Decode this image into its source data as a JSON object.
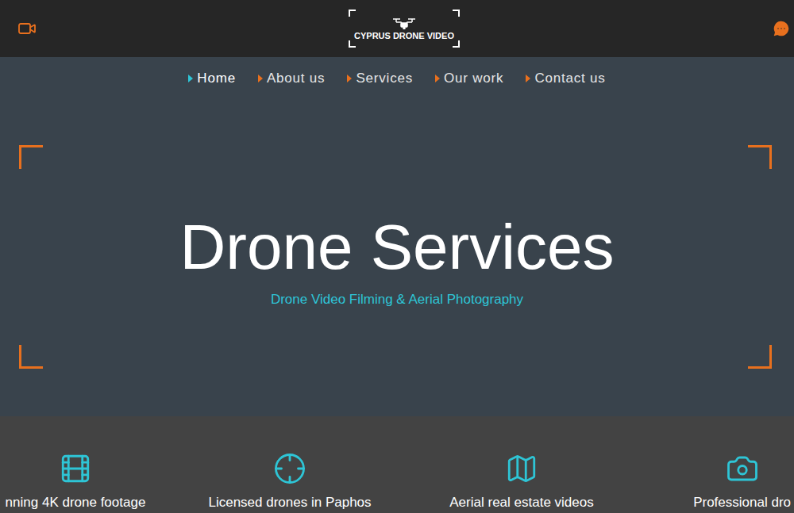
{
  "header": {
    "logo": "CYPRUS DRONE VIDEO"
  },
  "nav": [
    {
      "label": "Home",
      "selected": true
    },
    {
      "label": "About us",
      "selected": false
    },
    {
      "label": "Services",
      "selected": false
    },
    {
      "label": "Our work",
      "selected": false
    },
    {
      "label": "Contact us",
      "selected": false
    }
  ],
  "hero": {
    "title": "Drone Services",
    "subtitle": "Drone Video Filming & Aerial Photography"
  },
  "features": [
    {
      "label": "nning 4K drone footage"
    },
    {
      "label": "Licensed drones in Paphos"
    },
    {
      "label": "Aerial real estate videos"
    },
    {
      "label": "Professional dro"
    }
  ]
}
